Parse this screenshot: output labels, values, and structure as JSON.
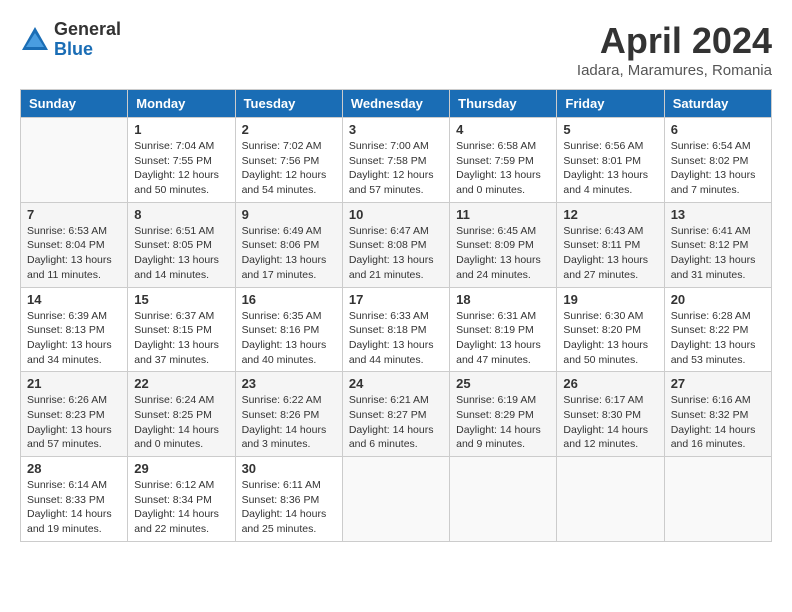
{
  "header": {
    "logo_general": "General",
    "logo_blue": "Blue",
    "month_title": "April 2024",
    "location": "Iadara, Maramures, Romania"
  },
  "weekdays": [
    "Sunday",
    "Monday",
    "Tuesday",
    "Wednesday",
    "Thursday",
    "Friday",
    "Saturday"
  ],
  "weeks": [
    [
      {
        "day": "",
        "sunrise": "",
        "sunset": "",
        "daylight": ""
      },
      {
        "day": "1",
        "sunrise": "Sunrise: 7:04 AM",
        "sunset": "Sunset: 7:55 PM",
        "daylight": "Daylight: 12 hours and 50 minutes."
      },
      {
        "day": "2",
        "sunrise": "Sunrise: 7:02 AM",
        "sunset": "Sunset: 7:56 PM",
        "daylight": "Daylight: 12 hours and 54 minutes."
      },
      {
        "day": "3",
        "sunrise": "Sunrise: 7:00 AM",
        "sunset": "Sunset: 7:58 PM",
        "daylight": "Daylight: 12 hours and 57 minutes."
      },
      {
        "day": "4",
        "sunrise": "Sunrise: 6:58 AM",
        "sunset": "Sunset: 7:59 PM",
        "daylight": "Daylight: 13 hours and 0 minutes."
      },
      {
        "day": "5",
        "sunrise": "Sunrise: 6:56 AM",
        "sunset": "Sunset: 8:01 PM",
        "daylight": "Daylight: 13 hours and 4 minutes."
      },
      {
        "day": "6",
        "sunrise": "Sunrise: 6:54 AM",
        "sunset": "Sunset: 8:02 PM",
        "daylight": "Daylight: 13 hours and 7 minutes."
      }
    ],
    [
      {
        "day": "7",
        "sunrise": "Sunrise: 6:53 AM",
        "sunset": "Sunset: 8:04 PM",
        "daylight": "Daylight: 13 hours and 11 minutes."
      },
      {
        "day": "8",
        "sunrise": "Sunrise: 6:51 AM",
        "sunset": "Sunset: 8:05 PM",
        "daylight": "Daylight: 13 hours and 14 minutes."
      },
      {
        "day": "9",
        "sunrise": "Sunrise: 6:49 AM",
        "sunset": "Sunset: 8:06 PM",
        "daylight": "Daylight: 13 hours and 17 minutes."
      },
      {
        "day": "10",
        "sunrise": "Sunrise: 6:47 AM",
        "sunset": "Sunset: 8:08 PM",
        "daylight": "Daylight: 13 hours and 21 minutes."
      },
      {
        "day": "11",
        "sunrise": "Sunrise: 6:45 AM",
        "sunset": "Sunset: 8:09 PM",
        "daylight": "Daylight: 13 hours and 24 minutes."
      },
      {
        "day": "12",
        "sunrise": "Sunrise: 6:43 AM",
        "sunset": "Sunset: 8:11 PM",
        "daylight": "Daylight: 13 hours and 27 minutes."
      },
      {
        "day": "13",
        "sunrise": "Sunrise: 6:41 AM",
        "sunset": "Sunset: 8:12 PM",
        "daylight": "Daylight: 13 hours and 31 minutes."
      }
    ],
    [
      {
        "day": "14",
        "sunrise": "Sunrise: 6:39 AM",
        "sunset": "Sunset: 8:13 PM",
        "daylight": "Daylight: 13 hours and 34 minutes."
      },
      {
        "day": "15",
        "sunrise": "Sunrise: 6:37 AM",
        "sunset": "Sunset: 8:15 PM",
        "daylight": "Daylight: 13 hours and 37 minutes."
      },
      {
        "day": "16",
        "sunrise": "Sunrise: 6:35 AM",
        "sunset": "Sunset: 8:16 PM",
        "daylight": "Daylight: 13 hours and 40 minutes."
      },
      {
        "day": "17",
        "sunrise": "Sunrise: 6:33 AM",
        "sunset": "Sunset: 8:18 PM",
        "daylight": "Daylight: 13 hours and 44 minutes."
      },
      {
        "day": "18",
        "sunrise": "Sunrise: 6:31 AM",
        "sunset": "Sunset: 8:19 PM",
        "daylight": "Daylight: 13 hours and 47 minutes."
      },
      {
        "day": "19",
        "sunrise": "Sunrise: 6:30 AM",
        "sunset": "Sunset: 8:20 PM",
        "daylight": "Daylight: 13 hours and 50 minutes."
      },
      {
        "day": "20",
        "sunrise": "Sunrise: 6:28 AM",
        "sunset": "Sunset: 8:22 PM",
        "daylight": "Daylight: 13 hours and 53 minutes."
      }
    ],
    [
      {
        "day": "21",
        "sunrise": "Sunrise: 6:26 AM",
        "sunset": "Sunset: 8:23 PM",
        "daylight": "Daylight: 13 hours and 57 minutes."
      },
      {
        "day": "22",
        "sunrise": "Sunrise: 6:24 AM",
        "sunset": "Sunset: 8:25 PM",
        "daylight": "Daylight: 14 hours and 0 minutes."
      },
      {
        "day": "23",
        "sunrise": "Sunrise: 6:22 AM",
        "sunset": "Sunset: 8:26 PM",
        "daylight": "Daylight: 14 hours and 3 minutes."
      },
      {
        "day": "24",
        "sunrise": "Sunrise: 6:21 AM",
        "sunset": "Sunset: 8:27 PM",
        "daylight": "Daylight: 14 hours and 6 minutes."
      },
      {
        "day": "25",
        "sunrise": "Sunrise: 6:19 AM",
        "sunset": "Sunset: 8:29 PM",
        "daylight": "Daylight: 14 hours and 9 minutes."
      },
      {
        "day": "26",
        "sunrise": "Sunrise: 6:17 AM",
        "sunset": "Sunset: 8:30 PM",
        "daylight": "Daylight: 14 hours and 12 minutes."
      },
      {
        "day": "27",
        "sunrise": "Sunrise: 6:16 AM",
        "sunset": "Sunset: 8:32 PM",
        "daylight": "Daylight: 14 hours and 16 minutes."
      }
    ],
    [
      {
        "day": "28",
        "sunrise": "Sunrise: 6:14 AM",
        "sunset": "Sunset: 8:33 PM",
        "daylight": "Daylight: 14 hours and 19 minutes."
      },
      {
        "day": "29",
        "sunrise": "Sunrise: 6:12 AM",
        "sunset": "Sunset: 8:34 PM",
        "daylight": "Daylight: 14 hours and 22 minutes."
      },
      {
        "day": "30",
        "sunrise": "Sunrise: 6:11 AM",
        "sunset": "Sunset: 8:36 PM",
        "daylight": "Daylight: 14 hours and 25 minutes."
      },
      {
        "day": "",
        "sunrise": "",
        "sunset": "",
        "daylight": ""
      },
      {
        "day": "",
        "sunrise": "",
        "sunset": "",
        "daylight": ""
      },
      {
        "day": "",
        "sunrise": "",
        "sunset": "",
        "daylight": ""
      },
      {
        "day": "",
        "sunrise": "",
        "sunset": "",
        "daylight": ""
      }
    ]
  ]
}
